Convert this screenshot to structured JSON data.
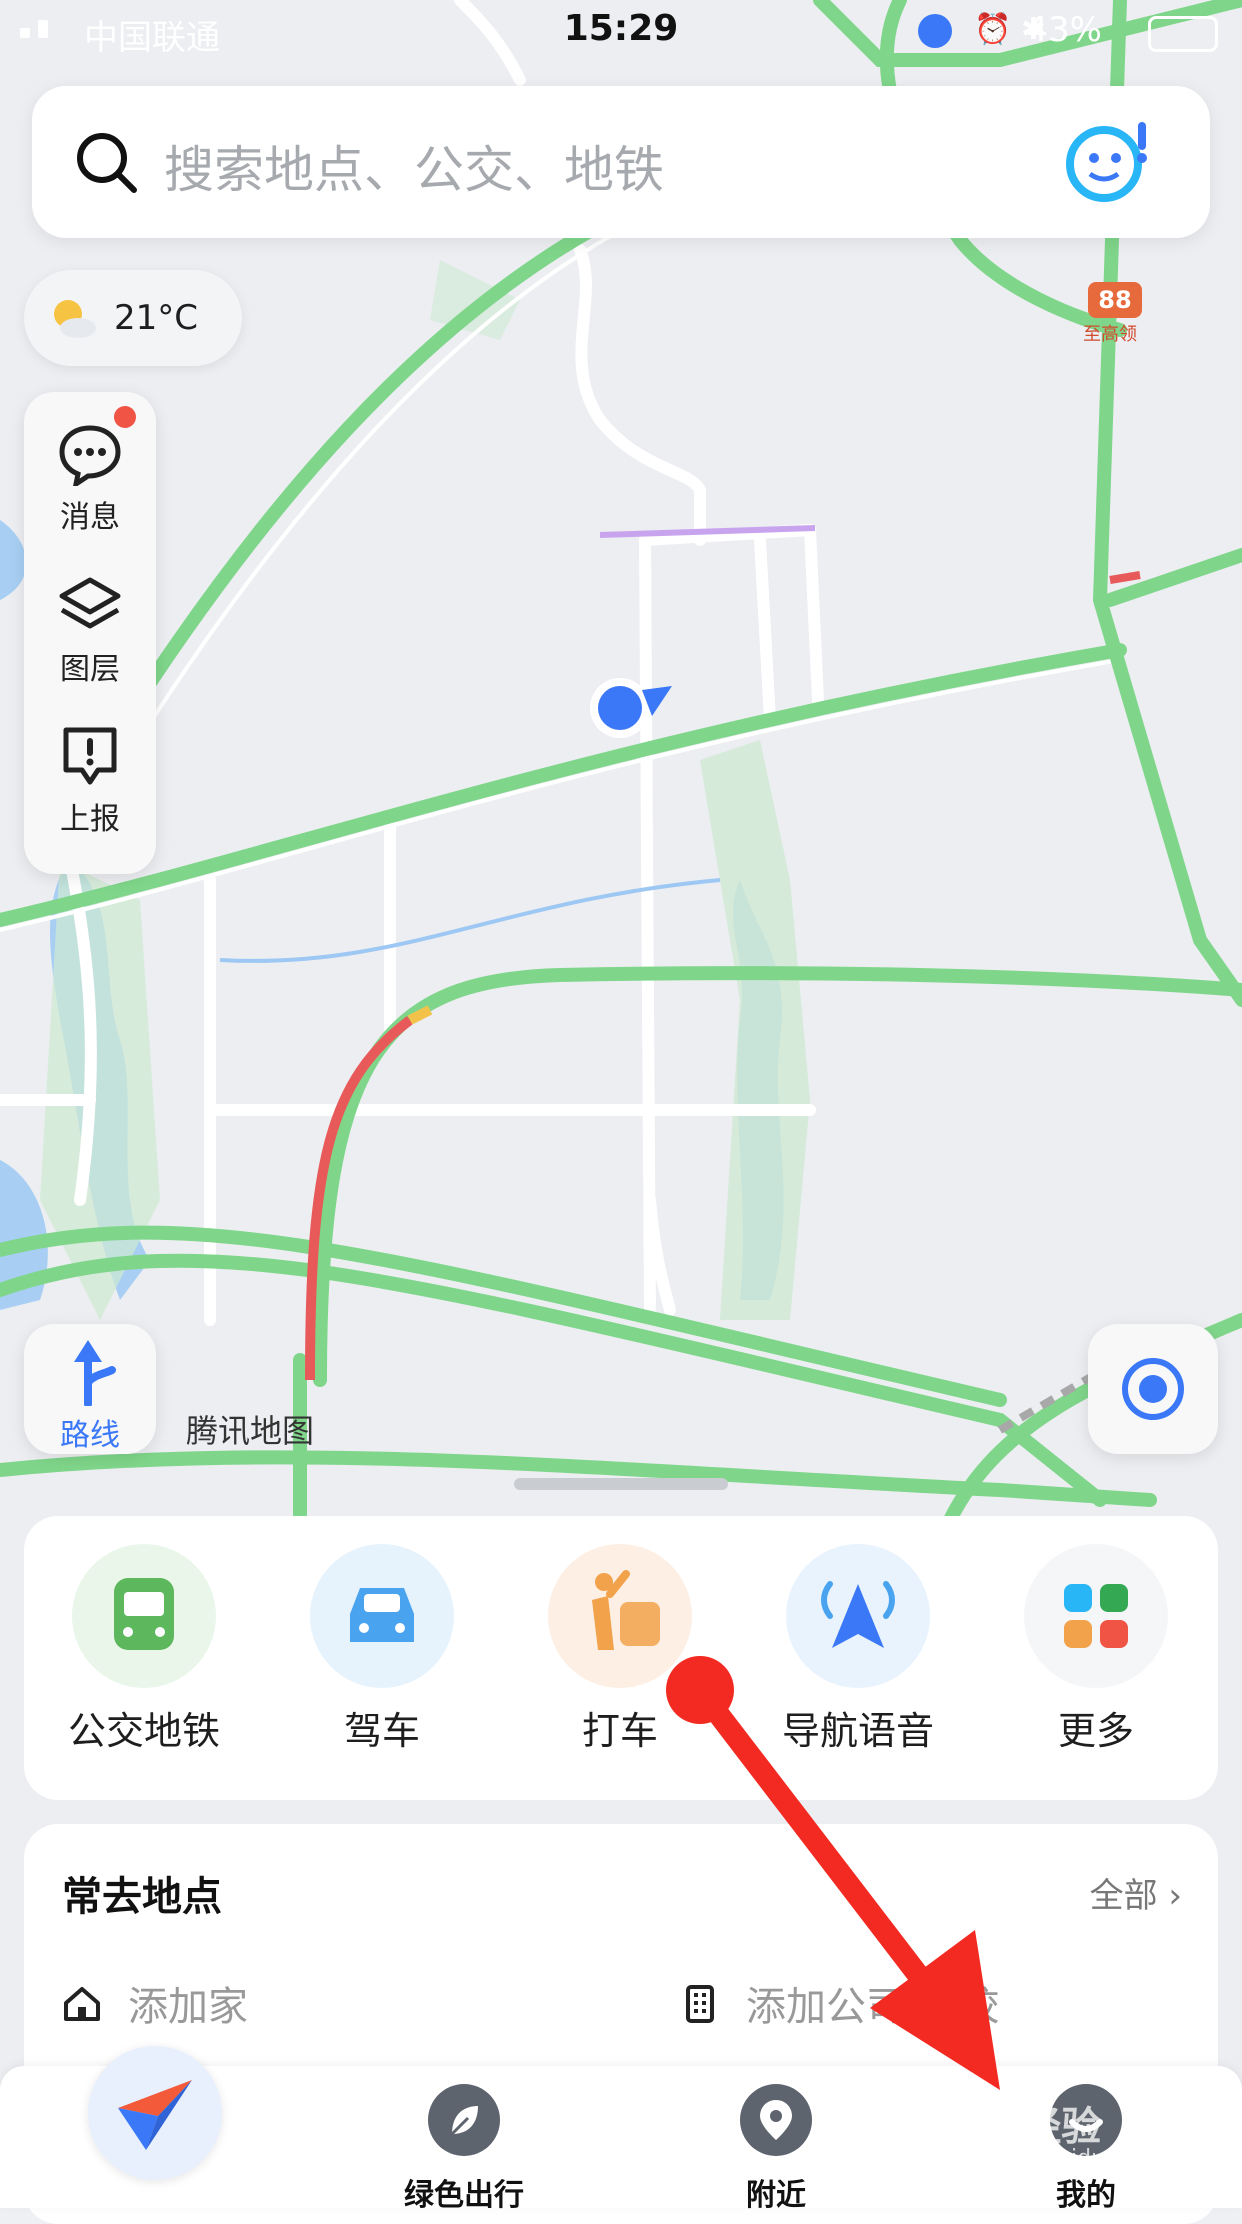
{
  "status_bar": {
    "carrier": "中国联通",
    "time": "15:29",
    "battery": "43%"
  },
  "search": {
    "placeholder": "搜索地点、公交、地铁"
  },
  "weather": {
    "temperature": "21°C",
    "icon": "partly-cloudy-icon"
  },
  "map": {
    "poi_label": "至高领",
    "poi_badge": "88",
    "attribution": "腾讯地图"
  },
  "map_tools": [
    {
      "label": "消息",
      "icon": "message-icon",
      "has_badge": true
    },
    {
      "label": "图层",
      "icon": "layers-icon"
    },
    {
      "label": "上报",
      "icon": "report-icon"
    }
  ],
  "route_button": {
    "label": "路线",
    "icon": "route-arrow-icon"
  },
  "services": [
    {
      "label": "公交地铁",
      "icon": "bus-icon",
      "color": "#5db85d"
    },
    {
      "label": "驾车",
      "icon": "car-icon",
      "color": "#4aa3ef"
    },
    {
      "label": "打车",
      "icon": "taxi-hail-icon",
      "color": "#f2a24a"
    },
    {
      "label": "导航语音",
      "icon": "navigation-voice-icon",
      "color": "#3b78f7"
    },
    {
      "label": "更多",
      "icon": "more-apps-icon",
      "color": "#34a853"
    }
  ],
  "frequent_places": {
    "title": "常去地点",
    "all_label": "全部",
    "home_label": "添加家",
    "work_label": "添加公司/学校"
  },
  "tabbar": {
    "tabs": [
      {
        "label": "",
        "icon": "compass-icon"
      },
      {
        "label": "绿色出行",
        "icon": "leaf-icon"
      },
      {
        "label": "附近",
        "icon": "location-pin-icon"
      },
      {
        "label": "我的",
        "icon": "profile-icon"
      }
    ]
  },
  "watermark": {
    "text": "Bai经验",
    "url_text": "jingyan.baidu.com"
  },
  "colors": {
    "road_green": "#7fd68a",
    "accent_blue": "#3b78f7",
    "annotation_red": "#f22a22"
  }
}
